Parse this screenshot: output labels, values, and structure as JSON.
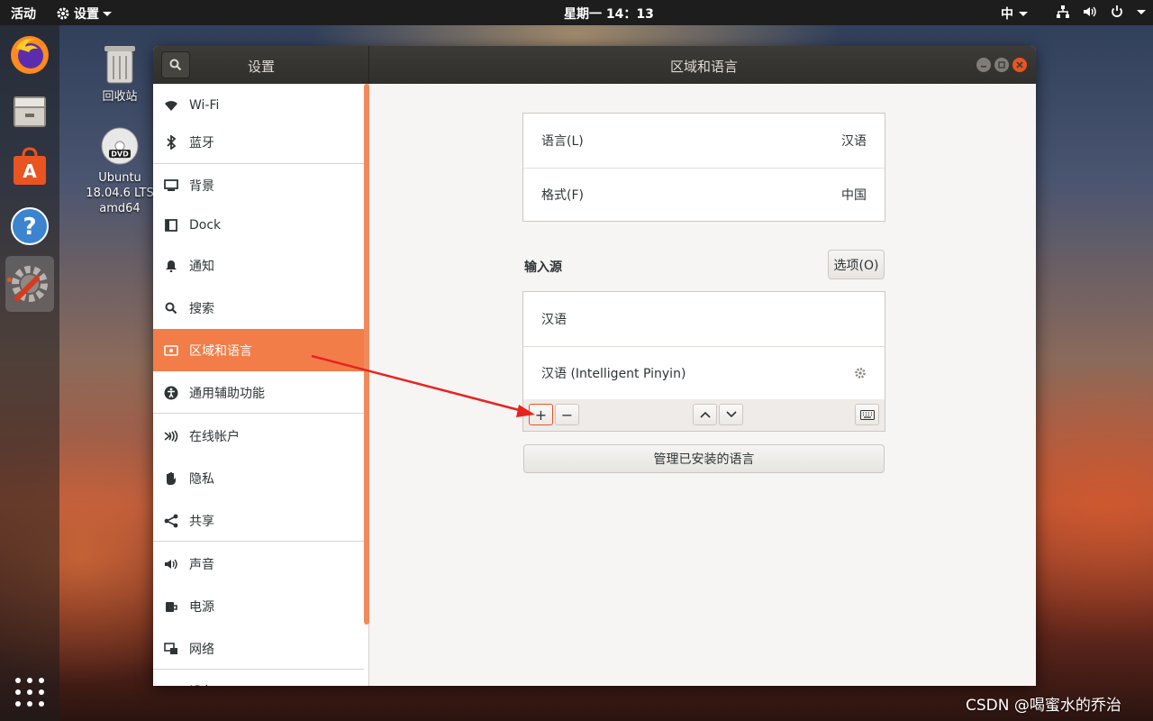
{
  "topbar": {
    "activities": "活动",
    "app_menu": "设置",
    "clock": "星期一 14：13",
    "input_method": "中",
    "status_icons": [
      "network-icon",
      "volume-icon",
      "power-icon"
    ]
  },
  "dock": {
    "items": [
      "firefox-icon",
      "files-icon",
      "software-icon",
      "help-icon",
      "settings-icon"
    ],
    "active": "settings-icon"
  },
  "desktop": {
    "trash_label": "回收站",
    "dvd_label_line1": "Ubuntu",
    "dvd_label_line2": "18.04.6 LTS",
    "dvd_label_line3": "amd64"
  },
  "window": {
    "sidebar_title": "设置",
    "page_title": "区域和语言"
  },
  "sidebar": {
    "items": [
      {
        "label": "Wi-Fi",
        "icon": "wifi-icon"
      },
      {
        "label": "蓝牙",
        "icon": "bluetooth-icon"
      },
      {
        "label": "背景",
        "icon": "background-icon"
      },
      {
        "label": "Dock",
        "icon": "dock-icon"
      },
      {
        "label": "通知",
        "icon": "bell-icon"
      },
      {
        "label": "搜索",
        "icon": "search-icon"
      },
      {
        "label": "区域和语言",
        "icon": "flag-icon",
        "selected": true
      },
      {
        "label": "通用辅助功能",
        "icon": "accessibility-icon"
      },
      {
        "label": "在线帐户",
        "icon": "online-accounts-icon"
      },
      {
        "label": "隐私",
        "icon": "hand-icon"
      },
      {
        "label": "共享",
        "icon": "share-icon"
      },
      {
        "label": "声音",
        "icon": "speaker-icon"
      },
      {
        "label": "电源",
        "icon": "power-icon"
      },
      {
        "label": "网络",
        "icon": "network-icon"
      },
      {
        "label": "设备",
        "icon": "printer-icon"
      }
    ]
  },
  "region": {
    "language_label": "语言(L)",
    "language_value": "汉语",
    "formats_label": "格式(F)",
    "formats_value": "中国"
  },
  "input_sources": {
    "title": "输入源",
    "options_button": "选项(O)",
    "items": [
      "汉语",
      "汉语 (Intelligent Pinyin)"
    ],
    "add_button": "+",
    "remove_button": "−"
  },
  "manage_languages_button": "管理已安装的语言",
  "watermark": "CSDN @喝蜜水的乔治",
  "colors": {
    "accent": "#E95420",
    "selection": "#F27D48",
    "annotation_arrow": "#E8231F"
  }
}
